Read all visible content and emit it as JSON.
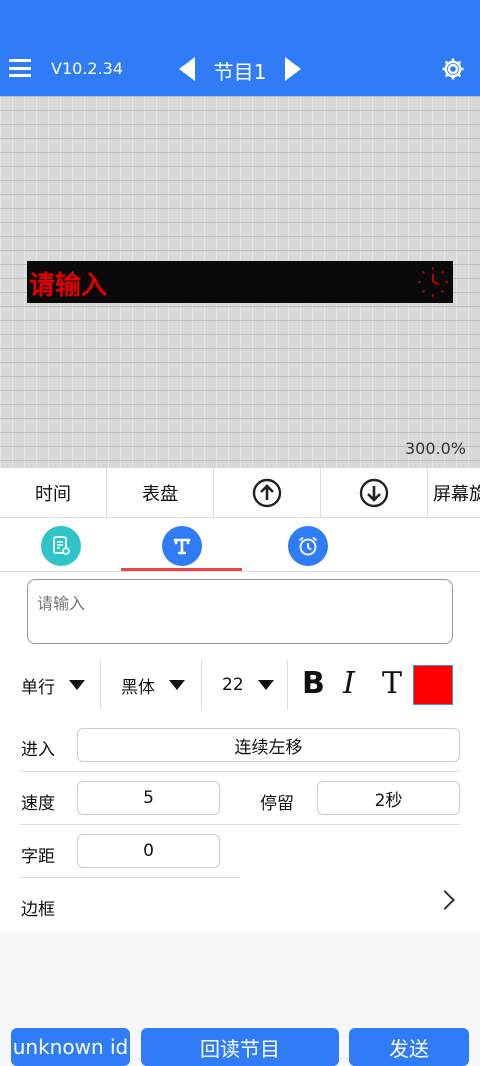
{
  "header": {
    "version": "V10.2.34",
    "program_title": "节目1"
  },
  "canvas": {
    "led_text": "请输入",
    "zoom": "300.0%",
    "led_text_color": "#e00000"
  },
  "toolbar": {
    "items": [
      {
        "label": "时间"
      },
      {
        "label": "表盘"
      },
      {
        "label": "",
        "icon": "arrow-up-icon"
      },
      {
        "label": "",
        "icon": "arrow-down-icon"
      },
      {
        "label": "屏幕旋"
      }
    ]
  },
  "tabs": [
    {
      "icon": "document-settings-icon"
    },
    {
      "icon": "text-icon",
      "active": true
    },
    {
      "icon": "alarm-clock-icon"
    }
  ],
  "text_input": {
    "placeholder": "请输入",
    "value": ""
  },
  "format": {
    "line_mode": "单行",
    "font": "黑体",
    "size": "22",
    "bold": "B",
    "italic": "I",
    "stroke": "T",
    "color": "#ff0000"
  },
  "form": {
    "enter_label": "进入",
    "enter_value": "连续左移",
    "speed_label": "速度",
    "speed_value": "5",
    "stay_label": "停留",
    "stay_value": "2秒",
    "spacing_label": "字距",
    "spacing_value": "0",
    "border_label": "边框"
  },
  "buttons": {
    "b1": "unknown id",
    "b2": "回读节目",
    "b3": "发送"
  },
  "colors": {
    "brand": "#2f7cf6",
    "tab_accent": "#ee4444"
  }
}
